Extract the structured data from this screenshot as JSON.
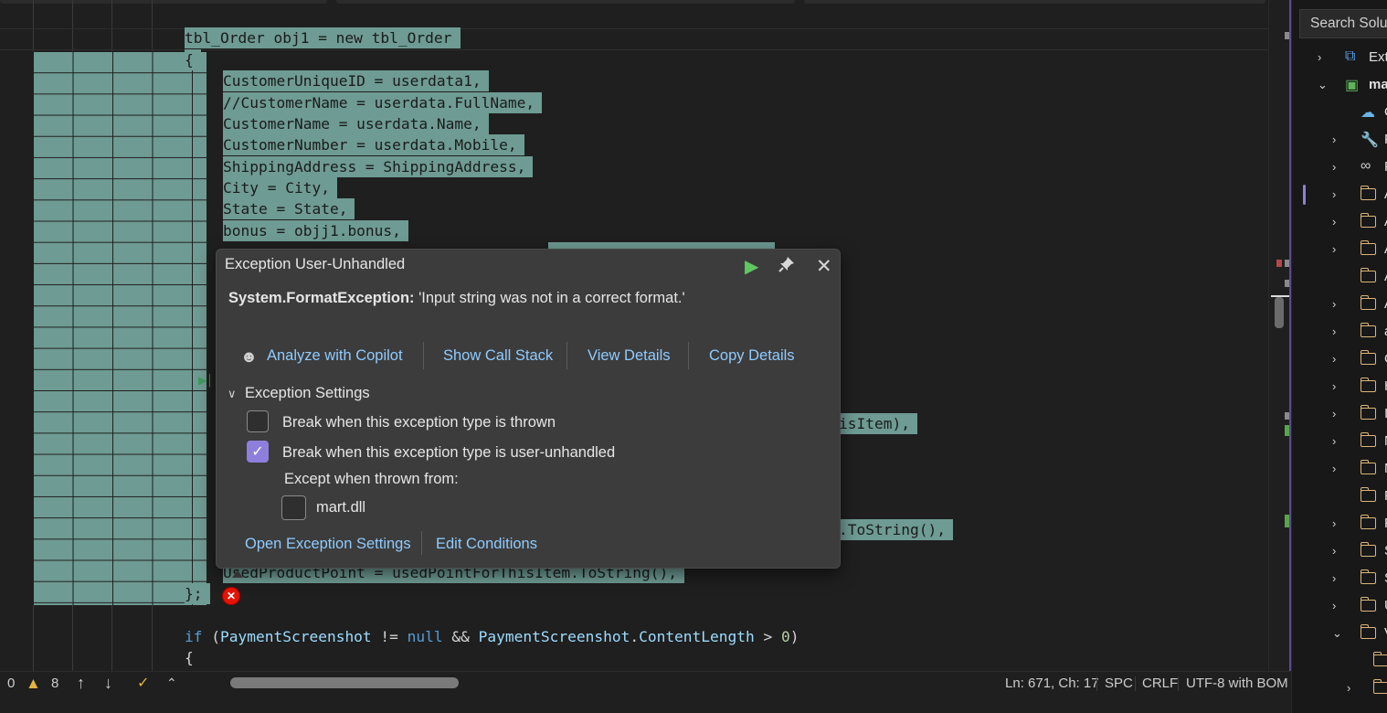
{
  "code": {
    "lines": [
      {
        "a": "tbl_Order",
        "b": " obj1 = new ",
        "c": "tbl_Order"
      },
      {
        "t": "{"
      },
      {
        "t": "CustomerUniqueID = userdata1,"
      },
      {
        "t": "//CustomerName = userdata.FullName,"
      },
      {
        "t": "CustomerName = userdata.Name,"
      },
      {
        "t": "CustomerNumber = userdata.Mobile,"
      },
      {
        "t": "ShippingAddress = ShippingAddress,"
      },
      {
        "t": "City = City,"
      },
      {
        "t": "State = State,"
      },
      {
        "t": "bonus = objj1.bonus,"
      },
      {
        "t": "isItem),"
      },
      {
        "t": ".ToString(),"
      },
      {
        "t": "UsedProductPoint = usedPointForThisItem.ToString(),"
      },
      {
        "t": "};"
      },
      {
        "kw": "if",
        "p1": " (",
        "pr1": "PaymentScreenshot",
        "op": " != ",
        "nl": "null",
        "and": " && ",
        "pr2": "PaymentScreenshot",
        "dot": ".",
        "pr3": "ContentLength",
        "gt": " > ",
        "num": "0",
        "close": ")"
      },
      {
        "t": "{"
      }
    ]
  },
  "popup": {
    "title": "Exception User-Unhandled",
    "continue_icon": "play-icon",
    "pin_icon": "pin-icon",
    "close_icon": "close-icon",
    "exception_type": "System.FormatException:",
    "exception_message": " 'Input string was not in a correct format.'",
    "actions": {
      "analyze": "Analyze with Copilot",
      "call_stack": "Show Call Stack",
      "view_details": "View Details",
      "copy_details": "Copy Details"
    },
    "settings_title": "Exception Settings",
    "option_thrown": "Break when this exception type is thrown",
    "option_thrown_checked": false,
    "option_unhandled": "Break when this exception type is user-unhandled",
    "option_unhandled_checked": true,
    "except_label": "Except when thrown from:",
    "module": "mart.dll",
    "module_checked": false,
    "open_settings": "Open Exception Settings",
    "edit_conditions": "Edit Conditions"
  },
  "status": {
    "errors": "0",
    "warnings": "8",
    "position": "Ln: 671, Ch: 17",
    "whitespace": "SPC",
    "line_ending": "CRLF",
    "encoding": "UTF-8 with BOM"
  },
  "solution": {
    "search_placeholder": "Search Soluti",
    "rows": [
      {
        "label": "Ext"
      },
      {
        "label": "ma"
      },
      {
        "label": "C"
      },
      {
        "label": "P"
      },
      {
        "label": "F"
      },
      {
        "label": "A"
      },
      {
        "label": "A"
      },
      {
        "label": "A"
      },
      {
        "label": "A"
      },
      {
        "label": "A"
      },
      {
        "label": "a"
      },
      {
        "label": "C"
      },
      {
        "label": "H"
      },
      {
        "label": "I"
      },
      {
        "label": "N"
      },
      {
        "label": "N"
      },
      {
        "label": "P"
      },
      {
        "label": "P"
      },
      {
        "label": "S"
      },
      {
        "label": "S"
      },
      {
        "label": "U"
      },
      {
        "label": "V"
      },
      {
        "label": ""
      },
      {
        "label": ""
      }
    ]
  },
  "colors": {
    "selection": "#6e9b93",
    "accent": "#8f7fdc",
    "link": "#8fcbff",
    "error": "#e51400"
  }
}
